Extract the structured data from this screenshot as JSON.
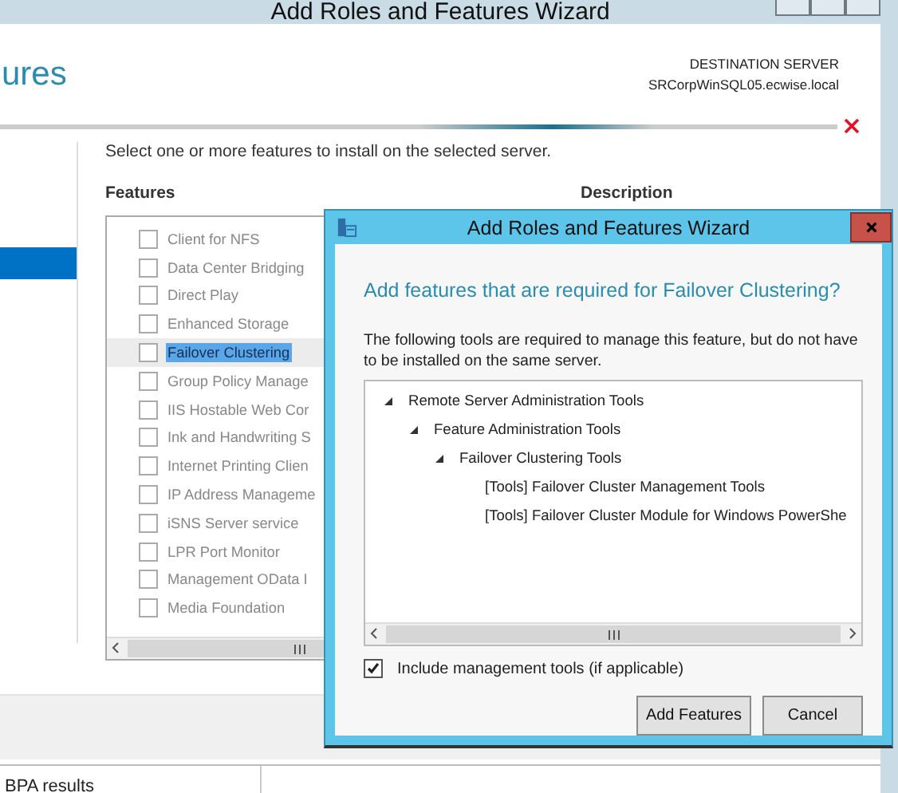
{
  "main_window": {
    "title": "Add Roles and Features Wizard",
    "page_heading": "ures",
    "destination_label": "DESTINATION SERVER",
    "destination_server": "SRCorpWinSQL05.ecwise.local",
    "nav_items": [
      {
        "selected": true
      }
    ],
    "instruction": "Select one or more features to install on the selected server.",
    "features_heading": "Features",
    "description_heading": "Description",
    "features": [
      {
        "label": "Client for NFS",
        "checked": false,
        "selected": false
      },
      {
        "label": "Data Center Bridging",
        "checked": false,
        "selected": false
      },
      {
        "label": "Direct Play",
        "checked": false,
        "selected": false
      },
      {
        "label": "Enhanced Storage",
        "checked": false,
        "selected": false
      },
      {
        "label": "Failover Clustering",
        "checked": false,
        "selected": true
      },
      {
        "label": "Group Policy Manage",
        "checked": false,
        "selected": false
      },
      {
        "label": "IIS Hostable Web Cor",
        "checked": false,
        "selected": false
      },
      {
        "label": "Ink and Handwriting S",
        "checked": false,
        "selected": false
      },
      {
        "label": "Internet Printing Clien",
        "checked": false,
        "selected": false
      },
      {
        "label": "IP Address Manageme",
        "checked": false,
        "selected": false
      },
      {
        "label": "iSNS Server service",
        "checked": false,
        "selected": false
      },
      {
        "label": "LPR Port Monitor",
        "checked": false,
        "selected": false
      },
      {
        "label": "Management OData I",
        "checked": false,
        "selected": false
      },
      {
        "label": "Media Foundation",
        "checked": false,
        "selected": false
      }
    ],
    "status_bar": "BPA results"
  },
  "dialog": {
    "title": "Add Roles and Features Wizard",
    "heading": "Add features that are required for Failover Clustering?",
    "message": "The following tools are required to manage this feature, but do not have to be installed on the same server.",
    "tree": [
      {
        "label": "Remote Server Administration Tools",
        "expanded": true,
        "children": [
          {
            "label": "Feature Administration Tools",
            "expanded": true,
            "children": [
              {
                "label": "Failover Clustering Tools",
                "expanded": true,
                "children": [
                  {
                    "label": "[Tools] Failover Cluster Management Tools"
                  },
                  {
                    "label": "[Tools] Failover Cluster Module for Windows PowerShe"
                  }
                ]
              }
            ]
          }
        ]
      }
    ],
    "include_tools": {
      "label": "Include management tools (if applicable)",
      "checked": true
    },
    "buttons": [
      "Add Features",
      "Cancel"
    ]
  }
}
